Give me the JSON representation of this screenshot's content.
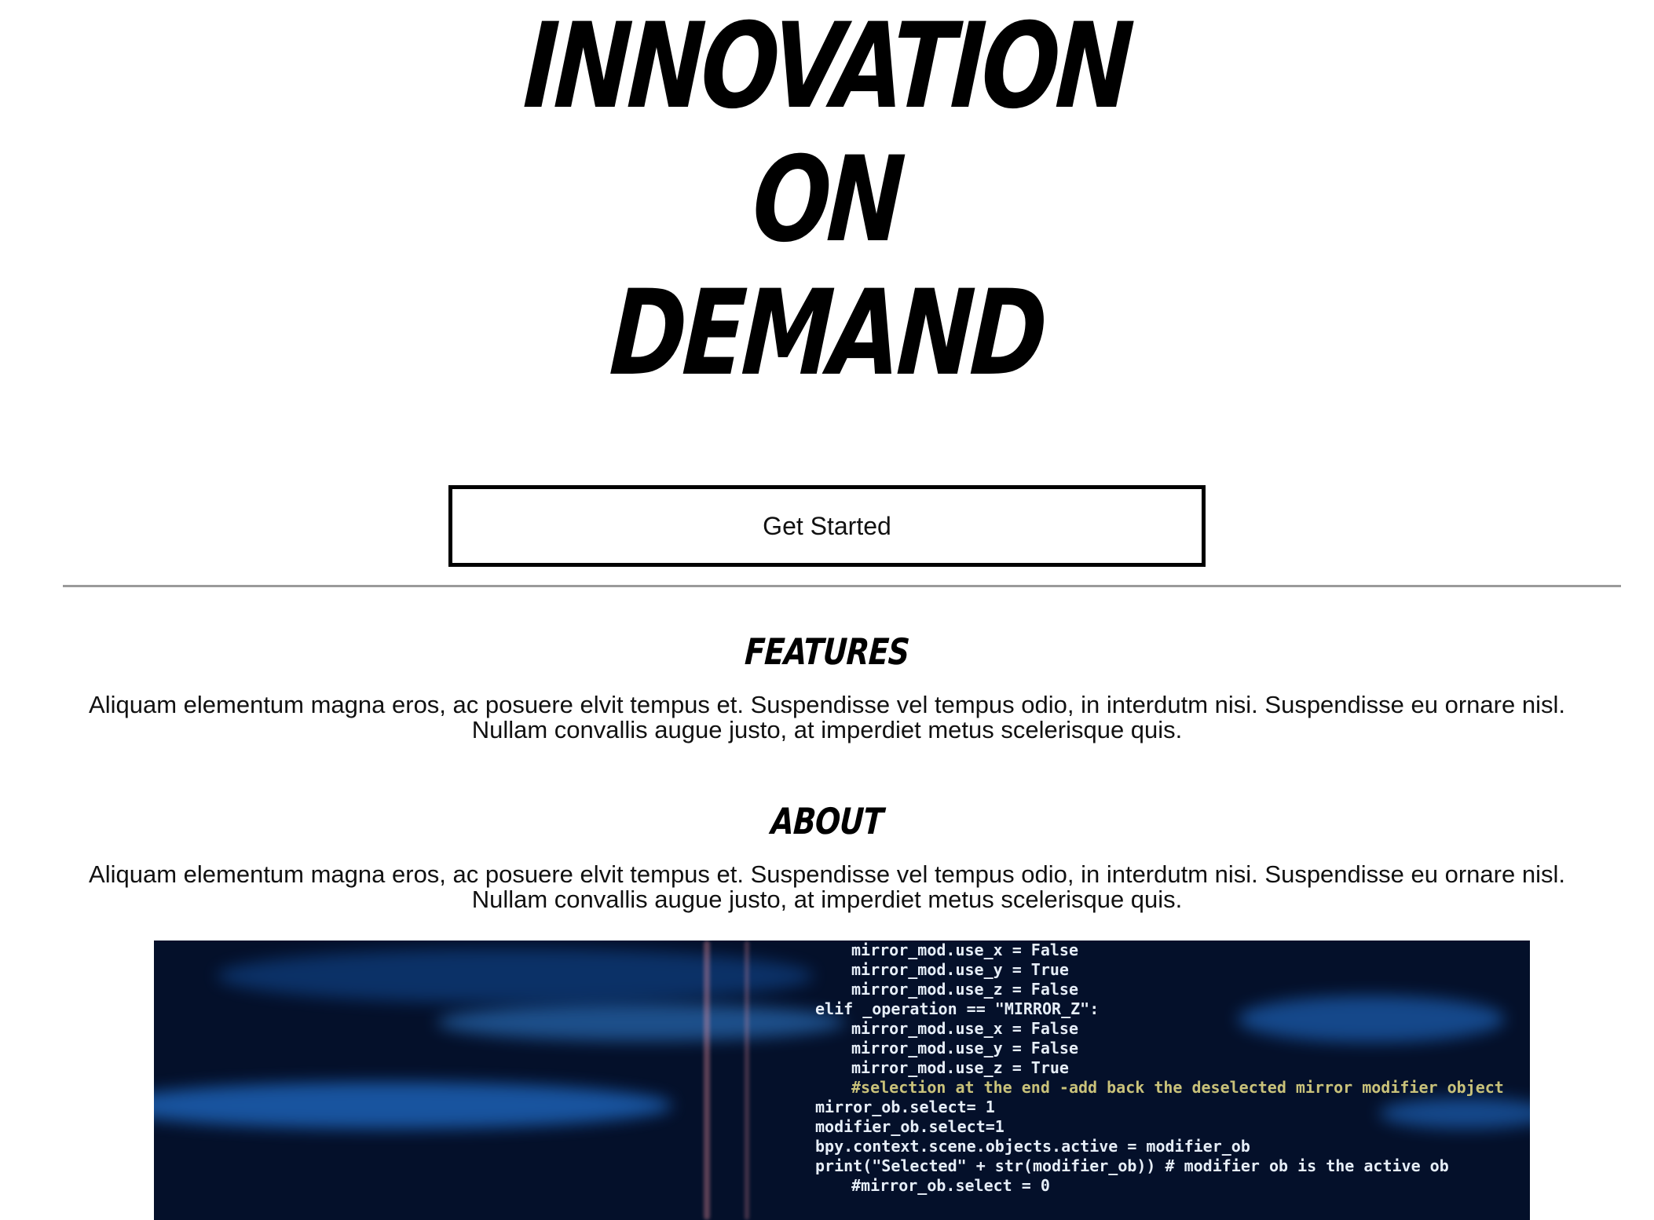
{
  "hero": {
    "title_lines": [
      "INNOVATION",
      "ON",
      "DEMAND"
    ]
  },
  "cta": {
    "label": "Get Started"
  },
  "features": {
    "heading": "FEATURES",
    "text": "Aliquam elementum magna eros, ac posuere elvit tempus et. Suspendisse vel tempus odio, in interdutm nisi. Suspendisse eu ornare nisl. Nullam convallis augue justo, at imperdiet metus scelerisque quis."
  },
  "about": {
    "heading": "ABOUT",
    "text": "Aliquam elementum magna eros, ac posuere elvit tempus et. Suspendisse vel tempus odio, in interdutm nisi. Suspendisse eu ornare nisl. Nullam convallis augue justo, at imperdiet metus scelerisque quis."
  },
  "image": {
    "code_lines": [
      "mirror_mod.use_x = False",
      "mirror_mod.use_y = True",
      "mirror_mod.use_z = False",
      "elif _operation == \"MIRROR_Z\":",
      "mirror_mod.use_x = False",
      "mirror_mod.use_y = False",
      "mirror_mod.use_z = True",
      "",
      "#selection at the end -add back the deselected mirror modifier object",
      "mirror_ob.select= 1",
      "modifier_ob.select=1",
      "bpy.context.scene.objects.active = modifier_ob",
      "print(\"Selected\" + str(modifier_ob)) # modifier ob is the active ob",
      "#mirror_ob.select = 0"
    ]
  },
  "colors": {
    "background": "#ffffff",
    "text": "#111111",
    "border": "#000000",
    "divider": "#9a9a9a",
    "image_background": "#04102a",
    "image_glow": "#2a8cff"
  }
}
